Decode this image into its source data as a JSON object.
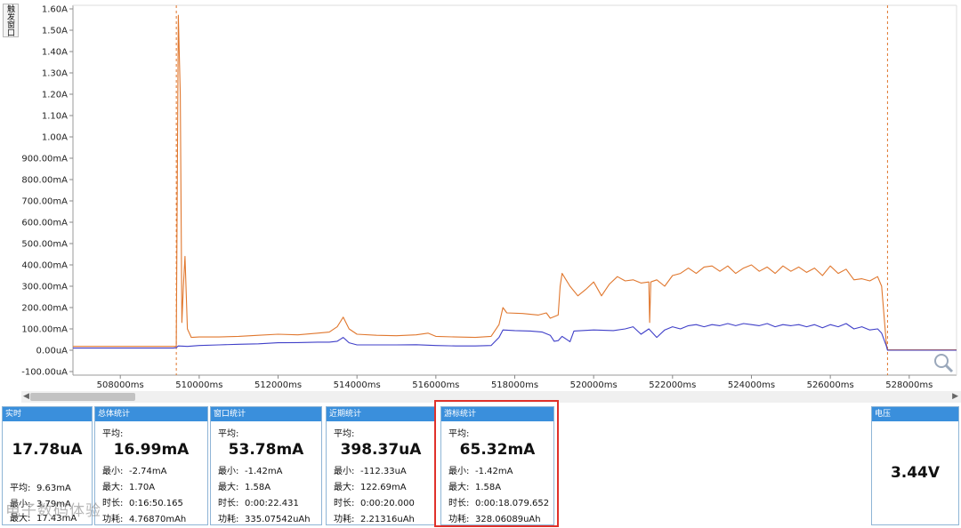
{
  "trigger_tab": "触发窗口",
  "chart_data": {
    "type": "line",
    "xlabel": "",
    "ylabel": "",
    "xlim": [
      506800,
      529200
    ],
    "ylim": [
      -100,
      1600
    ],
    "x_ticks": [
      {
        "v": 508000,
        "label": "508000ms"
      },
      {
        "v": 510000,
        "label": "510000ms"
      },
      {
        "v": 512000,
        "label": "512000ms"
      },
      {
        "v": 514000,
        "label": "514000ms"
      },
      {
        "v": 516000,
        "label": "516000ms"
      },
      {
        "v": 518000,
        "label": "518000ms"
      },
      {
        "v": 520000,
        "label": "520000ms"
      },
      {
        "v": 522000,
        "label": "522000ms"
      },
      {
        "v": 524000,
        "label": "524000ms"
      },
      {
        "v": 526000,
        "label": "526000ms"
      },
      {
        "v": 528000,
        "label": "528000ms"
      }
    ],
    "y_ticks": [
      {
        "v": 1600,
        "label": "1.60A"
      },
      {
        "v": 1500,
        "label": "1.50A"
      },
      {
        "v": 1400,
        "label": "1.40A"
      },
      {
        "v": 1300,
        "label": "1.30A"
      },
      {
        "v": 1200,
        "label": "1.20A"
      },
      {
        "v": 1100,
        "label": "1.10A"
      },
      {
        "v": 1000,
        "label": "1.00A"
      },
      {
        "v": 900,
        "label": "900.00mA"
      },
      {
        "v": 800,
        "label": "800.00mA"
      },
      {
        "v": 700,
        "label": "700.00mA"
      },
      {
        "v": 600,
        "label": "600.00mA"
      },
      {
        "v": 500,
        "label": "500.00mA"
      },
      {
        "v": 400,
        "label": "400.00mA"
      },
      {
        "v": 300,
        "label": "300.00mA"
      },
      {
        "v": 200,
        "label": "200.00mA"
      },
      {
        "v": 100,
        "label": "100.00mA"
      },
      {
        "v": 0,
        "label": "0.00uA"
      },
      {
        "v": -100,
        "label": "-100.00uA"
      }
    ],
    "markers": [
      509420,
      527450
    ],
    "series": [
      {
        "color": "#e0772e",
        "points": [
          [
            506800,
            18
          ],
          [
            509350,
            18
          ],
          [
            509420,
            18
          ],
          [
            509470,
            1570
          ],
          [
            509520,
            1200
          ],
          [
            509560,
            130
          ],
          [
            509600,
            300
          ],
          [
            509640,
            440
          ],
          [
            509700,
            100
          ],
          [
            509800,
            60
          ],
          [
            510000,
            62
          ],
          [
            510500,
            62
          ],
          [
            511000,
            65
          ],
          [
            511500,
            70
          ],
          [
            512000,
            75
          ],
          [
            512500,
            72
          ],
          [
            513000,
            80
          ],
          [
            513300,
            85
          ],
          [
            513500,
            110
          ],
          [
            513650,
            155
          ],
          [
            513800,
            100
          ],
          [
            514000,
            75
          ],
          [
            514500,
            70
          ],
          [
            515000,
            68
          ],
          [
            515500,
            72
          ],
          [
            515800,
            80
          ],
          [
            516000,
            65
          ],
          [
            516500,
            62
          ],
          [
            517000,
            60
          ],
          [
            517400,
            65
          ],
          [
            517600,
            120
          ],
          [
            517700,
            200
          ],
          [
            517800,
            175
          ],
          [
            518200,
            172
          ],
          [
            518600,
            165
          ],
          [
            518800,
            175
          ],
          [
            518900,
            150
          ],
          [
            519100,
            165
          ],
          [
            519150,
            300
          ],
          [
            519200,
            360
          ],
          [
            519400,
            300
          ],
          [
            519600,
            255
          ],
          [
            519800,
            285
          ],
          [
            520000,
            320
          ],
          [
            520200,
            255
          ],
          [
            520400,
            310
          ],
          [
            520600,
            345
          ],
          [
            520800,
            325
          ],
          [
            521000,
            330
          ],
          [
            521200,
            315
          ],
          [
            521400,
            320
          ],
          [
            521420,
            130
          ],
          [
            521450,
            320
          ],
          [
            521600,
            330
          ],
          [
            521800,
            300
          ],
          [
            522000,
            350
          ],
          [
            522200,
            360
          ],
          [
            522400,
            385
          ],
          [
            522600,
            360
          ],
          [
            522800,
            390
          ],
          [
            523000,
            395
          ],
          [
            523200,
            370
          ],
          [
            523400,
            395
          ],
          [
            523600,
            360
          ],
          [
            523800,
            385
          ],
          [
            524000,
            400
          ],
          [
            524200,
            370
          ],
          [
            524400,
            390
          ],
          [
            524600,
            360
          ],
          [
            524800,
            395
          ],
          [
            525000,
            370
          ],
          [
            525200,
            390
          ],
          [
            525400,
            365
          ],
          [
            525600,
            385
          ],
          [
            525800,
            350
          ],
          [
            526000,
            395
          ],
          [
            526200,
            360
          ],
          [
            526400,
            380
          ],
          [
            526600,
            330
          ],
          [
            526800,
            335
          ],
          [
            527000,
            325
          ],
          [
            527200,
            345
          ],
          [
            527300,
            300
          ],
          [
            527420,
            30
          ],
          [
            527450,
            2
          ],
          [
            529200,
            2
          ]
        ]
      },
      {
        "color": "#3f3fc8",
        "points": [
          [
            506800,
            10
          ],
          [
            509350,
            10
          ],
          [
            509420,
            12
          ],
          [
            509470,
            20
          ],
          [
            509700,
            18
          ],
          [
            510000,
            22
          ],
          [
            510500,
            25
          ],
          [
            511000,
            28
          ],
          [
            511500,
            30
          ],
          [
            512000,
            35
          ],
          [
            512500,
            36
          ],
          [
            513000,
            38
          ],
          [
            513300,
            38
          ],
          [
            513500,
            42
          ],
          [
            513650,
            60
          ],
          [
            513800,
            35
          ],
          [
            514000,
            25
          ],
          [
            514500,
            25
          ],
          [
            515000,
            25
          ],
          [
            515500,
            26
          ],
          [
            516000,
            22
          ],
          [
            516500,
            20
          ],
          [
            517000,
            20
          ],
          [
            517400,
            22
          ],
          [
            517600,
            60
          ],
          [
            517700,
            95
          ],
          [
            518000,
            92
          ],
          [
            518400,
            90
          ],
          [
            518700,
            85
          ],
          [
            518900,
            70
          ],
          [
            519000,
            42
          ],
          [
            519100,
            45
          ],
          [
            519200,
            65
          ],
          [
            519400,
            40
          ],
          [
            519500,
            90
          ],
          [
            520000,
            95
          ],
          [
            520500,
            92
          ],
          [
            520800,
            100
          ],
          [
            521000,
            110
          ],
          [
            521200,
            75
          ],
          [
            521400,
            100
          ],
          [
            521600,
            60
          ],
          [
            521800,
            95
          ],
          [
            522000,
            110
          ],
          [
            522200,
            100
          ],
          [
            522400,
            115
          ],
          [
            522600,
            120
          ],
          [
            522800,
            110
          ],
          [
            523000,
            120
          ],
          [
            523200,
            115
          ],
          [
            523400,
            125
          ],
          [
            523600,
            115
          ],
          [
            523800,
            125
          ],
          [
            524000,
            120
          ],
          [
            524200,
            115
          ],
          [
            524400,
            125
          ],
          [
            524600,
            110
          ],
          [
            524800,
            120
          ],
          [
            525000,
            115
          ],
          [
            525200,
            120
          ],
          [
            525400,
            110
          ],
          [
            525600,
            120
          ],
          [
            525800,
            105
          ],
          [
            526000,
            120
          ],
          [
            526200,
            110
          ],
          [
            526400,
            125
          ],
          [
            526600,
            100
          ],
          [
            526800,
            110
          ],
          [
            527000,
            95
          ],
          [
            527200,
            100
          ],
          [
            527300,
            80
          ],
          [
            527420,
            20
          ],
          [
            527450,
            0
          ],
          [
            529200,
            0
          ]
        ]
      }
    ]
  },
  "panels": {
    "realtime": {
      "title": "实时",
      "value": "17.78uA",
      "rows": [
        {
          "k": "平均:",
          "v": "9.63mA"
        },
        {
          "k": "最小:",
          "v": "3.79mA"
        },
        {
          "k": "最大:",
          "v": "17.43mA"
        }
      ]
    },
    "overall": {
      "title": "总体统计",
      "avg_label": "平均:",
      "value": "16.99mA",
      "rows": [
        {
          "k": "最小:",
          "v": "-2.74mA"
        },
        {
          "k": "最大:",
          "v": "1.70A"
        },
        {
          "k": "时长:",
          "v": "0:16:50.165"
        },
        {
          "k": "功耗:",
          "v": "4.76870mAh"
        }
      ]
    },
    "window": {
      "title": "窗口统计",
      "avg_label": "平均:",
      "value": "53.78mA",
      "rows": [
        {
          "k": "最小:",
          "v": "-1.42mA"
        },
        {
          "k": "最大:",
          "v": "1.58A"
        },
        {
          "k": "时长:",
          "v": "0:00:22.431"
        },
        {
          "k": "功耗:",
          "v": "335.07542uAh"
        }
      ]
    },
    "recent": {
      "title": "近期统计",
      "avg_label": "平均:",
      "value": "398.37uA",
      "rows": [
        {
          "k": "最小:",
          "v": "-112.33uA"
        },
        {
          "k": "最大:",
          "v": "122.69mA"
        },
        {
          "k": "时长:",
          "v": "0:00:20.000"
        },
        {
          "k": "功耗:",
          "v": "2.21316uAh"
        }
      ]
    },
    "cursor": {
      "title": "游标统计",
      "avg_label": "平均:",
      "value": "65.32mA",
      "rows": [
        {
          "k": "最小:",
          "v": "-1.42mA"
        },
        {
          "k": "最大:",
          "v": "1.58A"
        },
        {
          "k": "时长:",
          "v": "0:00:18.079.652"
        },
        {
          "k": "功耗:",
          "v": "328.06089uAh"
        }
      ]
    },
    "voltage": {
      "title": "电压",
      "value": "3.44V"
    }
  },
  "watermark": "电子数码体验",
  "colors": {
    "header": "#3a8fdc",
    "highlight": "#e0312a",
    "current": "#e0772e",
    "average": "#3f3fc8"
  }
}
